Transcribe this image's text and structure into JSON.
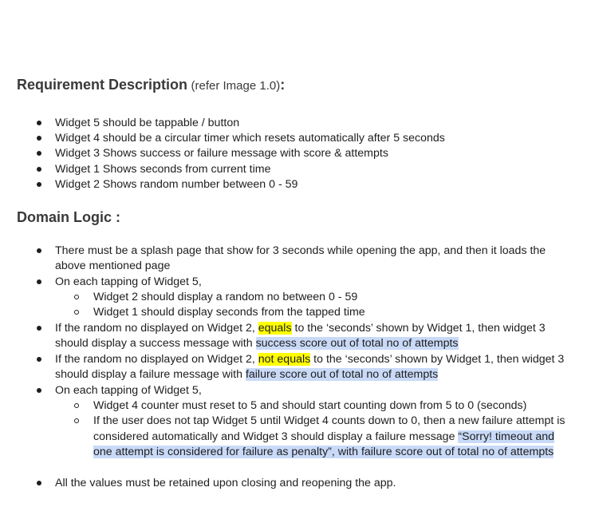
{
  "section1": {
    "title": "Requirement Description",
    "subtitle": "(refer Image 1.0)",
    "colon": ":",
    "items": [
      "Widget 5 should be tappable / button",
      "Widget 4 should be a circular timer which resets automatically after 5 seconds",
      "Widget 3 Shows success or failure message with score & attempts",
      "Widget 1 Shows seconds from current time",
      "Widget 2 Shows random number between 0 - 59"
    ]
  },
  "section2": {
    "title": "Domain Logic :",
    "b1": {
      "l1": "There must be a splash page that show for 3 seconds while opening the app, and then it loads the",
      "l2": "above mentioned page"
    },
    "b2": {
      "l1": "On each tapping of Widget 5,",
      "sub1": "Widget 2 should display a random no between 0 - 59",
      "sub2": "Widget 1 should display seconds from the tapped time"
    },
    "b3": {
      "pre": "If the random no displayed on Widget 2, ",
      "hl": "equals",
      "post": " to the ‘seconds’ shown by Widget 1, then  widget 3",
      "l2pre": "should display a success message with ",
      "l2hl": "success score out of total no of attempts"
    },
    "b4": {
      "pre": "If the random no displayed on Widget 2, ",
      "hl": "not equals",
      "post": " to the ‘seconds’ shown by Widget 1, then  widget 3",
      "l2pre": "should display a failure message with ",
      "l2hl": "failure score out of total no of attempts"
    },
    "b5": {
      "l1": "On each tapping of Widget 5,",
      "sub1": "Widget 4 counter must reset to 5 and should start counting down from 5 to 0 (seconds)",
      "sub2l1": "If the user does not tap Widget 5 until Widget 4 counts down to 0, then a new failure attempt is",
      "sub2l2pre": "considered automatically and Widget 3  should display a failure message ",
      "sub2l2hl": "“Sorry! timeout and",
      "sub2l3hl": "one attempt is considered for failure as penalty”, with failure score out of total no of attempts"
    },
    "b6": "All the values must be retained upon closing and reopening the app."
  },
  "colors": {
    "highlight_yellow": "#ffff00",
    "highlight_blue": "#c9daf8",
    "text": "#1e1e1e",
    "heading": "#3a3a3a"
  }
}
